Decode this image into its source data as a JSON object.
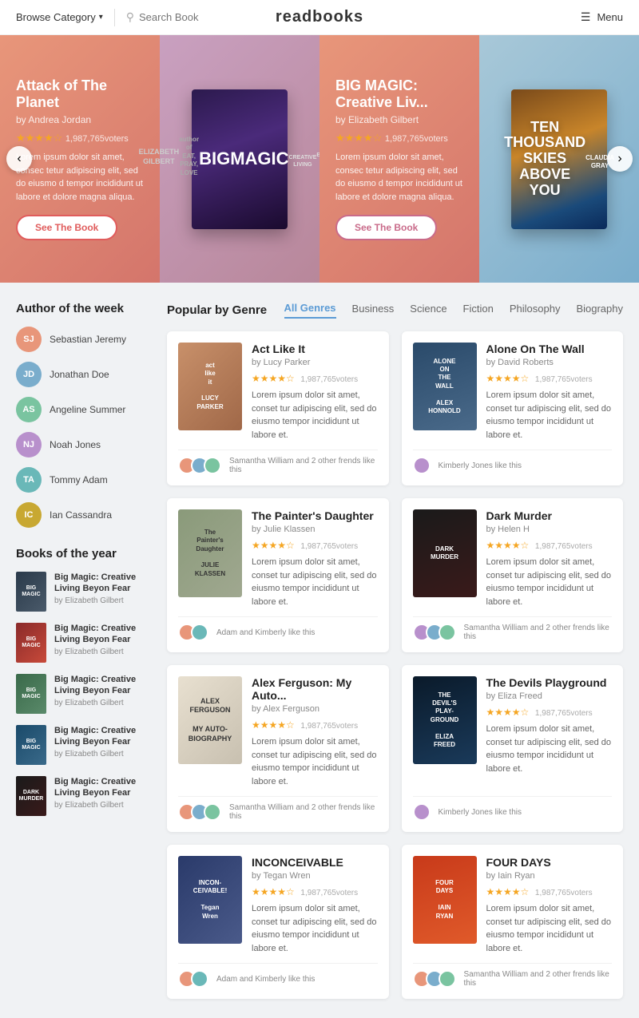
{
  "navbar": {
    "browse_label": "Browse Category",
    "search_placeholder": "Search Book",
    "logo": "readbooks",
    "menu_label": "Menu"
  },
  "hero": {
    "prev_btn": "‹",
    "next_btn": "›",
    "slides": [
      {
        "title": "Attack of The Planet",
        "author": "by Andrea Jordan",
        "stars": 4,
        "voters": "1,987,765voters",
        "description": "Lorem ipsum dolor sit amet, consectetur adipiscing elit, sed do eiusmo d tempor incididunt ut labore et dolore magna aliqua.",
        "btn_label": "See The Book",
        "type": "text"
      },
      {
        "title": "BIG MAGIC",
        "subtitle": "CREATIVE LIVING BEYOND FEAR",
        "author": "Elizabeth Gilbert",
        "subtext": "author of EAT, PRAY, LOVE",
        "type": "cover"
      },
      {
        "title": "BIG MAGIC: Creative Liv...",
        "author": "by Elizabeth Gilbert",
        "stars": 4,
        "voters": "1,987,765voters",
        "description": "Lorem ipsum dolor sit amet, consectetur adipiscing elit, sed do eiusmo d tempor incididunt ut labore et dolore magna aliqua.",
        "btn_label": "See The Book",
        "type": "text"
      },
      {
        "title": "TEN THOUSAND SKIES ABOVE YOU",
        "author": "Claudia Gray",
        "type": "cover-text"
      }
    ]
  },
  "sidebar": {
    "author_section_title": "Author of the week",
    "authors": [
      {
        "name": "Sebastian Jeremy",
        "initials": "SJ",
        "color": "av-orange"
      },
      {
        "name": "Jonathan Doe",
        "initials": "JD",
        "color": "av-blue"
      },
      {
        "name": "Angeline Summer",
        "initials": "AS",
        "color": "av-green"
      },
      {
        "name": "Noah Jones",
        "initials": "NJ",
        "color": "av-purple"
      },
      {
        "name": "Tommy Adam",
        "initials": "TA",
        "color": "av-teal"
      },
      {
        "name": "Ian Cassandra",
        "initials": "IC",
        "color": "av-gold"
      }
    ],
    "books_section_title": "Books of the year",
    "books_of_year": [
      {
        "title": "Big Magic: Creative Living Beyon Fear",
        "author": "by Elizabeth Gilbert",
        "cover_class": "sbc-1"
      },
      {
        "title": "Big Magic: Creative Living Beyon Fear",
        "author": "by Elizabeth Gilbert",
        "cover_class": "sbc-2"
      },
      {
        "title": "Big Magic: Creative Living Beyon Fear",
        "author": "by Elizabeth Gilbert",
        "cover_class": "sbc-3"
      },
      {
        "title": "Big Magic: Creative Living Beyon Fear",
        "author": "by Elizabeth Gilbert",
        "cover_class": "sbc-4"
      },
      {
        "title": "Big Magic: Creative Living Beyon Fear",
        "author": "by Elizabeth Gilbert",
        "cover_class": "sbc-5"
      }
    ]
  },
  "genre": {
    "section_title": "Popular by Genre",
    "tabs": [
      {
        "label": "All Genres",
        "active": true
      },
      {
        "label": "Business",
        "active": false
      },
      {
        "label": "Science",
        "active": false
      },
      {
        "label": "Fiction",
        "active": false
      },
      {
        "label": "Philosophy",
        "active": false
      },
      {
        "label": "Biography",
        "active": false
      }
    ]
  },
  "books": [
    {
      "title": "Act Like It",
      "author": "by Lucy Parker",
      "stars": 4,
      "voters": "1,987,765voters",
      "description": "Lorem ipsum dolor sit amet, conset tur adipiscing elit, sed do eiusmo tempor incididunt ut labore et.",
      "cover_class": "bc-act",
      "cover_text": "act like it LUCY PARKER",
      "likes_text": "Samantha William and 2 other frends like this",
      "avatars": [
        "av-orange",
        "av-blue",
        "av-green"
      ]
    },
    {
      "title": "Alone On The Wall",
      "author": "by David Roberts",
      "stars": 4,
      "voters": "1,987,765voters",
      "description": "Lorem ipsum dolor sit amet, conset tur adipiscing elit, sed do eiusmo tempor incididunt ut labore et.",
      "cover_class": "bc-alone",
      "cover_text": "ALONE ON THE WALL ALEX HONNOLD",
      "likes_text": "Kimberly Jones like this",
      "avatars": [
        "av-purple"
      ]
    },
    {
      "title": "The Painter's Daughter",
      "author": "by Julie Klassen",
      "stars": 4,
      "voters": "1,987,765voters",
      "description": "Lorem ipsum dolor sit amet, conset tur adipiscing elit, sed do eiusmo tempor incididunt ut labore et.",
      "cover_class": "bc-painter",
      "cover_text": "The Painter's Daughter JULIE KLASSEN",
      "likes_text": "Adam and Kimberly  like this",
      "avatars": [
        "av-orange",
        "av-teal"
      ]
    },
    {
      "title": "Dark Murder",
      "author": "by Helen H",
      "stars": 4,
      "voters": "1,987,765voters",
      "description": "Lorem ipsum dolor sit amet, conset tur adipiscing elit, sed do eiusmo tempor incididunt ut labore et.",
      "cover_class": "bc-dark",
      "cover_text": "DARK MURDER",
      "likes_text": "Samantha William and 2 other frends like this",
      "avatars": [
        "av-purple",
        "av-blue",
        "av-green"
      ]
    },
    {
      "title": "Alex Ferguson: My Auto...",
      "author": "by Alex Ferguson",
      "stars": 4,
      "voters": "1,987,765voters",
      "description": "Lorem ipsum dolor sit amet, conset tur adipiscing elit, sed do eiusmo tempor incididunt ut labore et.",
      "cover_class": "bc-ferguson",
      "cover_text": "ALEX FERGUSON MY AUTOBIOGRAPHY",
      "likes_text": "Samantha William and 2 other frends like this",
      "avatars": [
        "av-orange",
        "av-blue",
        "av-green"
      ]
    },
    {
      "title": "The Devils Playground",
      "author": "by Eliza Freed",
      "stars": 4,
      "voters": "1,987,765voters",
      "description": "Lorem ipsum dolor sit amet, conset tur adipiscing elit, sed do eiusmo tempor incididunt ut labore et.",
      "cover_class": "bc-devils",
      "cover_text": "THE DEVIL'S PLAYGROUND ELIZA FREED",
      "likes_text": "Kimberly Jones like this",
      "avatars": [
        "av-purple"
      ]
    },
    {
      "title": "INCONCEIVABLE",
      "author": "by Tegan Wren",
      "stars": 4,
      "voters": "1,987,765voters",
      "description": "Lorem ipsum dolor sit amet, conset tur adipiscing elit, sed do eiusmo tempor incididunt ut labore et.",
      "cover_class": "bc-inconceivable",
      "cover_text": "INCONCEIVABLE! Tegan Wren",
      "likes_text": "Adam and Kimberly  like this",
      "avatars": [
        "av-orange",
        "av-teal"
      ]
    },
    {
      "title": "FOUR DAYS",
      "author": "by Iain Ryan",
      "stars": 4,
      "voters": "1,987,765voters",
      "description": "Lorem ipsum dolor sit amet, conset tur adipiscing elit, sed do eiusmo tempor incididunt ut labore et.",
      "cover_class": "bc-fourdays",
      "cover_text": "FOUR DAYS IAIN RYAN",
      "likes_text": "Samantha William and 2 other frends like this",
      "avatars": [
        "av-orange",
        "av-blue",
        "av-green"
      ]
    }
  ]
}
